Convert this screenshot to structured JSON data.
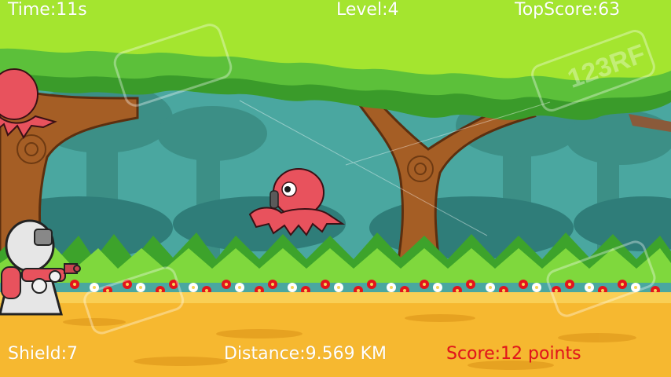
{
  "hud": {
    "time": "Time:11s",
    "level": "Level:4",
    "top_score": "TopScore:63",
    "shield": "Shield:7",
    "distance": "Distance:9.569 KM",
    "score": "Score:12 points"
  },
  "watermark": "123RF",
  "colors": {
    "hud_text": "#ffffff",
    "score_text": "#e4141b",
    "canopy": "#a4e52f",
    "sky_forest": "#4aa7a0",
    "ground": "#f6b830",
    "octopus": "#e8525d"
  },
  "icons": [
    "octopus-enemy",
    "robot-player",
    "laser-gun"
  ]
}
